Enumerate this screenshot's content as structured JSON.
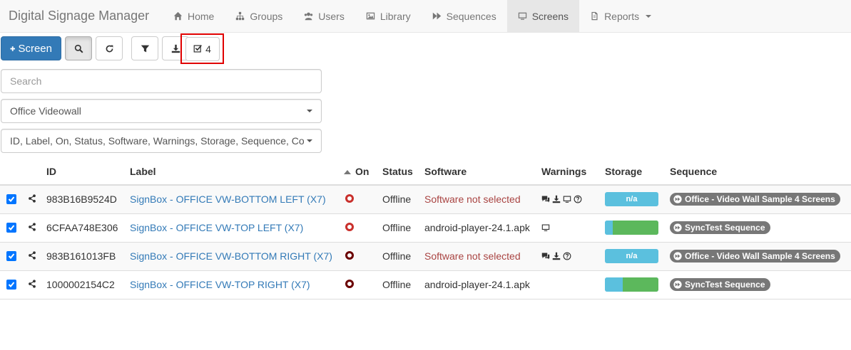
{
  "app": {
    "title": "Digital Signage Manager"
  },
  "nav": [
    {
      "label": "Home",
      "icon": "home-icon"
    },
    {
      "label": "Groups",
      "icon": "sitemap-icon"
    },
    {
      "label": "Users",
      "icon": "users-icon"
    },
    {
      "label": "Library",
      "icon": "image-icon"
    },
    {
      "label": "Sequences",
      "icon": "fast-forward-icon"
    },
    {
      "label": "Screens",
      "icon": "monitor-icon",
      "active": true
    },
    {
      "label": "Reports",
      "icon": "file-icon",
      "dropdown": true
    }
  ],
  "toolbar": {
    "add_label": "Screen",
    "selected_count": "4"
  },
  "filters": {
    "search_placeholder": "Search",
    "group_value": "Office Videowall",
    "columns_value": "ID, Label, On, Status, Software, Warnings, Storage, Sequence, Co"
  },
  "table": {
    "headers": {
      "id": "ID",
      "label": "Label",
      "on": "On",
      "status": "Status",
      "software": "Software",
      "warnings": "Warnings",
      "storage": "Storage",
      "sequence": "Sequence"
    },
    "rows": [
      {
        "id": "983B16B9524D",
        "label": "SignBox - OFFICE VW-BOTTOM LEFT (X7)",
        "status": "Offline",
        "software": "Software not selected",
        "software_error": true,
        "warnings": [
          "comments-icon",
          "download-icon",
          "monitor-icon",
          "question-icon"
        ],
        "storage_text": "n/a",
        "storage_used": null,
        "sequence": "Office - Video Wall Sample 4 Screens",
        "on_dark": false
      },
      {
        "id": "6CFAA748E306",
        "label": "SignBox - OFFICE VW-TOP LEFT (X7)",
        "status": "Offline",
        "software": "android-player-24.1.apk",
        "software_error": false,
        "warnings": [
          "monitor-icon"
        ],
        "storage_text": "",
        "storage_used": 0.15,
        "sequence": "SyncTest Sequence",
        "on_dark": false
      },
      {
        "id": "983B161013FB",
        "label": "SignBox - OFFICE VW-BOTTOM RIGHT (X7)",
        "status": "Offline",
        "software": "Software not selected",
        "software_error": true,
        "warnings": [
          "comments-icon",
          "download-icon",
          "question-icon"
        ],
        "storage_text": "n/a",
        "storage_used": null,
        "sequence": "Office - Video Wall Sample 4 Screens",
        "on_dark": true
      },
      {
        "id": "1000002154C2",
        "label": "SignBox - OFFICE VW-TOP RIGHT (X7)",
        "status": "Offline",
        "software": "android-player-24.1.apk",
        "software_error": false,
        "warnings": [],
        "storage_text": "",
        "storage_used": 0.33,
        "sequence": "SyncTest Sequence",
        "on_dark": true
      }
    ]
  }
}
